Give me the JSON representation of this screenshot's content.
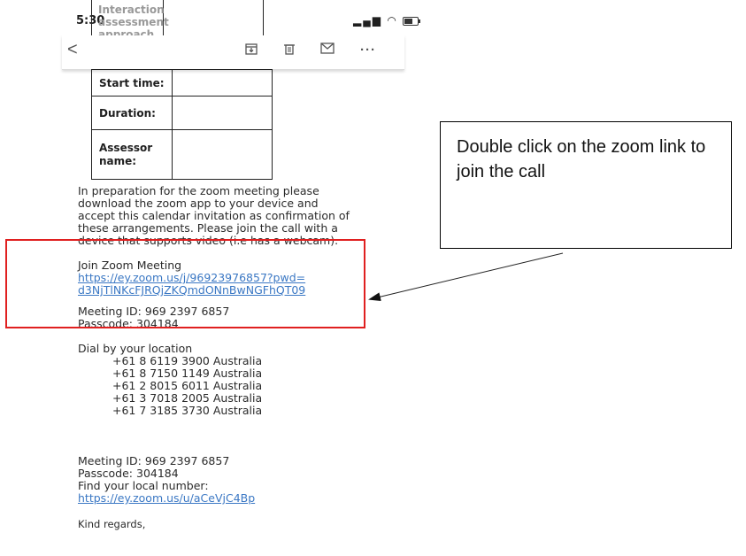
{
  "status_bar": {
    "time": "5:30",
    "icons": [
      "signal-icon",
      "wifi-icon",
      "battery-icon"
    ]
  },
  "toolbar": {
    "icons": [
      "back-icon",
      "archive-icon",
      "delete-icon",
      "mail-icon",
      "more-icon"
    ]
  },
  "table": {
    "cut_label": [
      "Interaction",
      "assessment",
      "approach"
    ],
    "rows": [
      {
        "label": "Start time:",
        "value": ""
      },
      {
        "label": "Duration:",
        "value": ""
      },
      {
        "label": "Assessor\nname:",
        "value": ""
      }
    ]
  },
  "email": {
    "preparation": [
      "In preparation for the zoom meeting please",
      "download the zoom app to your device and",
      "accept this calendar invitation as confirmation of",
      "these arrangements. Please join the call with a",
      "device that supports video (i.e has a webcam)."
    ],
    "join_heading": "Join Zoom Meeting",
    "join_link_lines": [
      "https://ey.zoom.us/j/96923976857?pwd=",
      "d3NjTlNKcFJRQjZKQmdONnBwNGFhQT09"
    ],
    "meeting_id": "Meeting ID: 969 2397 6857",
    "passcode": "Passcode: 304184",
    "dial_heading": "Dial by your location",
    "dial_numbers": [
      "+61 8 6119 3900 Australia",
      "+61 8 7150 1149 Australia",
      "+61 2 8015 6011 Australia",
      "+61 3 7018 2005 Australia",
      "+61 7 3185 3730 Australia"
    ],
    "meeting_id_2": "Meeting ID: 969 2397 6857",
    "passcode_2": "Passcode: 304184",
    "find_local": "Find your local number:",
    "local_link": "https://ey.zoom.us/u/aCeVjC4Bp",
    "sign_off": "Kind regards,"
  },
  "annotation": {
    "callout_text": "Double click on the zoom link to join the call",
    "highlight_color": "#e02020",
    "link_color": "#3b78c4"
  }
}
